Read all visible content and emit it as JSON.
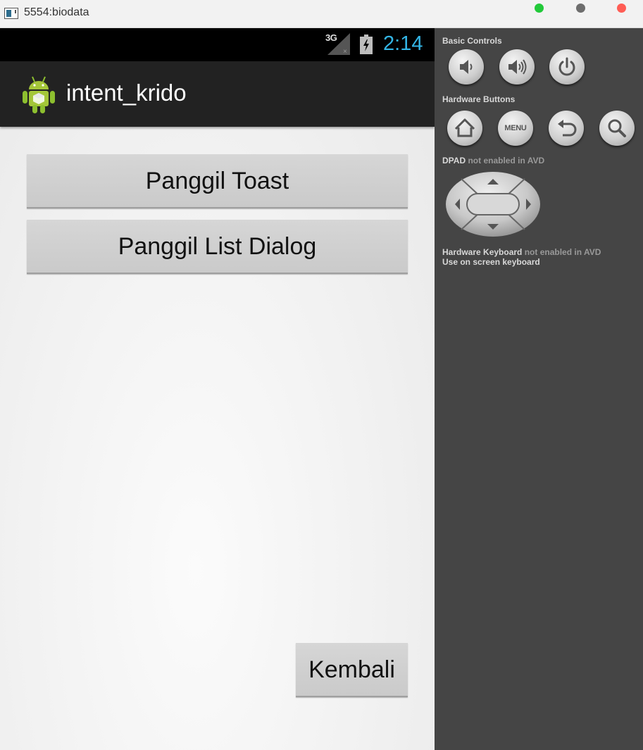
{
  "window": {
    "title": "5554:biodata"
  },
  "status_bar": {
    "network": "3G",
    "time": "2:14",
    "time_color": "#33b5e5"
  },
  "action_bar": {
    "app_name": "intent_krido",
    "icon": "android-robot-icon"
  },
  "content": {
    "toast_button_label": "Panggil Toast",
    "list_dialog_button_label": "Panggil List Dialog",
    "back_button_label": "Kembali"
  },
  "controls": {
    "basic_controls_label": "Basic Controls",
    "basic_controls": [
      "volume-down-icon",
      "volume-up-icon",
      "power-icon"
    ],
    "hardware_buttons_label": "Hardware Buttons",
    "hardware_buttons": [
      "home-icon",
      "menu-button",
      "back-arrow-icon",
      "search-icon"
    ],
    "menu_label": "MENU",
    "dpad_label": "DPAD",
    "dpad_note": "not enabled in AVD",
    "keyboard_label": "Hardware Keyboard",
    "keyboard_note": "not enabled in AVD",
    "screen_keyboard_label": "Use on screen keyboard"
  }
}
